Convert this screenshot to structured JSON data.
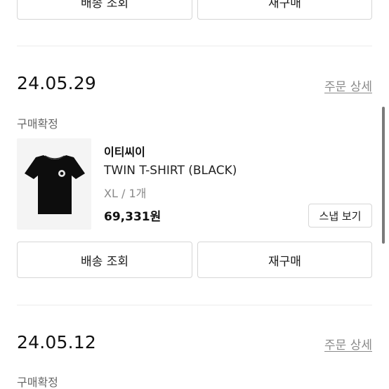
{
  "top_actions": {
    "shipping_label": "배송 조회",
    "reorder_label": "재구매"
  },
  "orders": [
    {
      "date": "24.05.29",
      "detail_link": "주문 상세",
      "status": "구매확정",
      "item": {
        "brand": "이티씨이",
        "name": "TWIN T-SHIRT (BLACK)",
        "option": "XL / 1개",
        "price": "69,331원",
        "snap_button": "스냅 보기"
      },
      "shipping_label": "배송 조회",
      "reorder_label": "재구매"
    },
    {
      "date": "24.05.12",
      "detail_link": "주문 상세",
      "status": "구매확정"
    }
  ],
  "colors": {
    "text": "#111111",
    "muted": "#8a8a8a",
    "border": "#d6d6d6",
    "divider": "#ececec",
    "thumb_bg": "#f4f4f4",
    "shirt": "#0d0d0d"
  }
}
